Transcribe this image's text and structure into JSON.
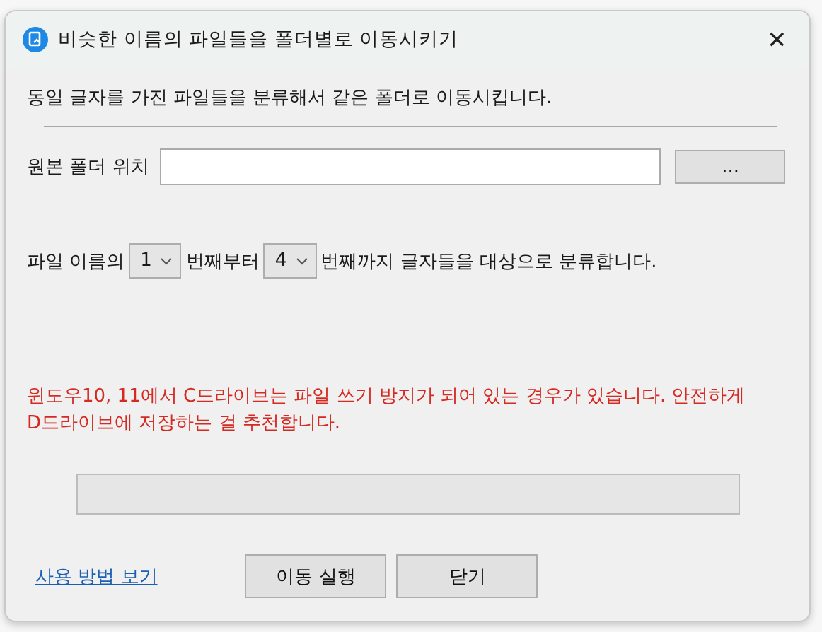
{
  "window": {
    "title": "비슷한 이름의 파일들을 폴더별로 이동시키기",
    "close": "✕"
  },
  "description": "동일 글자를 가진 파일들을 분류해서 같은 폴더로 이동시킵니다.",
  "source_folder": {
    "label": "원본 폴더 위치",
    "browse_button": "..."
  },
  "range": {
    "prefix": "파일 이름의",
    "from": "1",
    "middle": "번째부터",
    "to": "4",
    "suffix": "번째까지 글자들을 대상으로 분류합니다."
  },
  "warning": "윈도우10, 11에서 C드라이브는 파일 쓰기 방지가 되어 있는 경우가 있습니다. 안전하게 D드라이브에 저장하는 걸 추천합니다.",
  "help_link": "사용 방법 보기",
  "buttons": [
    "이동 실행",
    "닫기"
  ]
}
